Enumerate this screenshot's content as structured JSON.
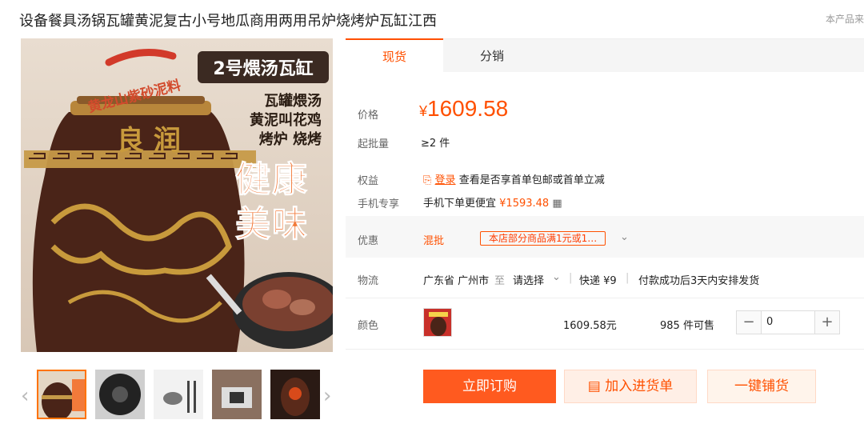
{
  "product": {
    "title": "设备餐具汤锅瓦罐黄泥复古小号地瓜商用两用吊炉烧烤炉瓦缸江西",
    "notice": "本产品来"
  },
  "image": {
    "badge_text": "2号煨汤瓦缸",
    "arc_text": "黄龙山紫砂泥料",
    "promo_lines": [
      "瓦罐煨汤",
      "黄泥叫花鸡",
      "烤炉 烧烤"
    ],
    "big_text_1": "健康",
    "big_text_2": "美味",
    "jar_text": "良 润"
  },
  "gallery": {
    "prev_label": "‹",
    "next_label": "›"
  },
  "tabs": [
    {
      "label": "现货"
    },
    {
      "label": "分销"
    }
  ],
  "pricing": {
    "price_label": "价格",
    "currency": "¥",
    "price": "1609.58",
    "moq_label": "起批量",
    "moq_value": "≥2 件"
  },
  "benefits": {
    "label": "权益",
    "login_link": "登录",
    "text": "查看是否享首单包邮或首单立减",
    "mobile_label": "手机专享",
    "mobile_text": "手机下单更便宜",
    "mobile_price": "¥1593.48"
  },
  "promo": {
    "label": "优惠",
    "type": "混批",
    "coupon": "本店部分商品满1元或1…"
  },
  "shipping": {
    "label": "物流",
    "origin": "广东省 广州市",
    "to": "至",
    "dest": "请选择",
    "express": "快递 ¥9",
    "dispatch": "付款成功后3天内安排发货"
  },
  "variant": {
    "label": "颜色",
    "price": "1609.58元",
    "stock": "985 件可售",
    "qty": "0",
    "minus": "−",
    "plus": "+"
  },
  "actions": {
    "buy": "立即订购",
    "cart": "加入进货单",
    "distribute": "一键铺货"
  }
}
